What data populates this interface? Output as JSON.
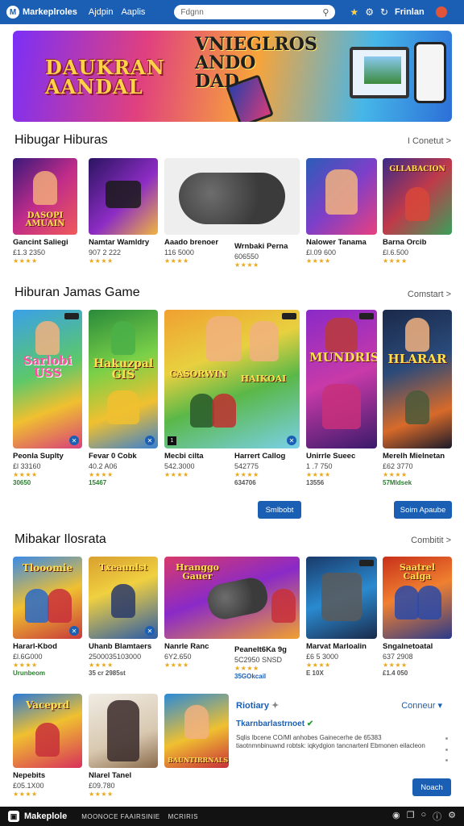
{
  "topbar": {
    "brand": "Markeplroles",
    "nav": [
      "Ajdpin",
      "Aaplis"
    ],
    "search_placeholder": "Fdgnn",
    "user": "Frinlan"
  },
  "banner": {
    "title_left": "DAUKRAN AANDAL",
    "title_right": "VNIEGLROS ANDO DAD"
  },
  "section1": {
    "title": "Hibugar Hiburas",
    "link": "I Conetut >",
    "items": [
      {
        "name": "Gancint Saliegi",
        "price": "£1.3 2350",
        "stars": "★★★★",
        "thumb_text": "DASOPI AMUAIN"
      },
      {
        "name": "Namtar Wamldry",
        "price": "907 2 222",
        "stars": "★★★★",
        "thumb_text": ""
      },
      {
        "name": "Aaado brenoer",
        "price": "116 5000",
        "stars": "★★★★",
        "thumb_text": ""
      },
      {
        "name": "Wrnbaki Perna",
        "price": "606550",
        "stars": "★★★★",
        "thumb_text": ""
      },
      {
        "name": "Nalower Tanama",
        "price": "£l.09 600",
        "stars": "★★★★",
        "thumb_text": ""
      },
      {
        "name": "Barna Orcib",
        "price": "£l.6.500",
        "stars": "★★★★",
        "thumb_text": "GLLABACION"
      }
    ]
  },
  "section2": {
    "title": "Hiburan Jamas Game",
    "link": "Comstart >",
    "items": [
      {
        "name": "Peonla Suplty",
        "price": "£l 33160",
        "stars": "★★★★",
        "extra": "30650",
        "thumb_text": "Sarlobi USS"
      },
      {
        "name": "Fevar 0 Cobk",
        "price": "40.2 A06",
        "stars": "★★★★",
        "extra": "15467",
        "thumb_text": "Hakuzpal GIS"
      },
      {
        "name": "Mecbi cilta",
        "price": "542.3000",
        "stars": "★★★★",
        "extra": "",
        "thumb_text": "CASORWIN"
      },
      {
        "name": "Harrert Callog",
        "price": "542775",
        "stars": "★★★★",
        "extra": "634706",
        "thumb_text": "HAIKOAI"
      },
      {
        "name": "Unirrle Sueec",
        "price": "1 .7 750",
        "stars": "★★★★",
        "extra": "13556",
        "thumb_text": "MUNDRIS"
      },
      {
        "name": "Merelh Mielnetan",
        "price": "£62 3770",
        "stars": "★★★★",
        "extra": "57Mldsek",
        "thumb_text": "HLARAR"
      }
    ],
    "btn1": "Smlbobt",
    "btn2": "Soim Apaube"
  },
  "section3": {
    "title": "Mibakar Ilosrata",
    "link": "Combitit >",
    "items": [
      {
        "name": "Hararl-Kbod",
        "price": "£l.6G000",
        "stars": "★★★★",
        "extra": "Urunbeom",
        "thumb_text": "Tlooomie"
      },
      {
        "name": "Uhanb Blamtaers",
        "price": "2500035103000",
        "stars": "★★★★",
        "extra": "35 cr 2985st",
        "thumb_text": "Txeaunlst"
      },
      {
        "name": "Nanrle Ranc",
        "price": "6Y2.650",
        "stars": "★★★★",
        "extra": "",
        "thumb_text": "Hranggo Gauer"
      },
      {
        "name": "Peanelt6Ka 9g",
        "price": "5C2950 SNSD",
        "stars": "★★★★",
        "extra": "35GOkcail",
        "thumb_text": ""
      },
      {
        "name": "Marvat Marloalin",
        "price": "£6 5 3000",
        "stars": "★★★★",
        "extra": "E 10X",
        "thumb_text": ""
      },
      {
        "name": "Sngalnetoatal",
        "price": "637 2908",
        "stars": "★★★★",
        "extra": "£1.4 050",
        "thumb_text": "Saatrel Calga"
      }
    ]
  },
  "section4": {
    "items": [
      {
        "name": "Nepebits",
        "price": "£05.1X00",
        "stars": "★★★★",
        "thumb_text": "Vaceprd"
      },
      {
        "name": "Nlarel Tanel",
        "price": "£09.780",
        "stars": "★★★★",
        "thumb_text": ""
      },
      {
        "name": "",
        "price": "",
        "stars": "",
        "thumb_text": "BAUNTIRRNALS"
      }
    ],
    "panel": {
      "title": "Riotiary",
      "link": "Conneur",
      "subtitle": "Tkarnbarlastrnoet",
      "description": "Sqlis Ibcene CO/Ml anhobes Gainecerhe de 65383 tiaotnmnbinuwnd robtsk: iqkydgion tancnartenl Ebmonen eilacleon"
    },
    "button": "Noach"
  },
  "footer": {
    "brand": "Makeplole",
    "links": [
      "MOONOCE FAAIRSINIE",
      "MCRIRIS"
    ]
  },
  "colors": {
    "brand": "#1a5fb4",
    "star": "#e8a81c",
    "accent_green": "#2e7d32"
  }
}
